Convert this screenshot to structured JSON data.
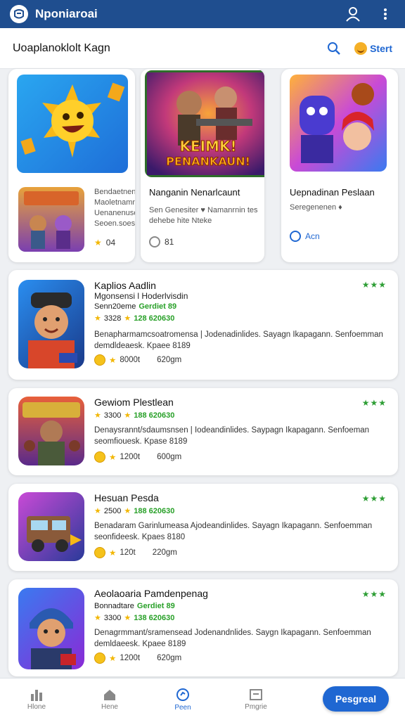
{
  "app": {
    "title": "Nponiaroai"
  },
  "subheader": {
    "title": "Uoaplanoklolt Kagn",
    "start_label": "Stert"
  },
  "featured": [
    {
      "title": "",
      "sub_lines": [
        "Bendaetnen",
        "Maoletnamn",
        "Uenanenuse",
        "Seoen.soes"
      ],
      "rating": "04"
    },
    {
      "title": "Nanganin Nenarlcaunt",
      "sub_lines": [
        "Sen Genesiter ♥ Namanrnin tes",
        "dehebe hite Nteke"
      ],
      "rating": "81",
      "banner_text": "PENANKAUN!",
      "banner_top": "KEIMK!"
    },
    {
      "title": "Uepnadinan Peslaan",
      "sub_lines": [
        "Seregenenen ♦"
      ],
      "rating": "Acn"
    }
  ],
  "list": [
    {
      "name": "Kaplios Aadlin",
      "subtitle": "Mgonsensi l Hoderlvisdin",
      "line2": "Senn20eme",
      "line2_green": "Gerdiet 89",
      "rating_line": "3328",
      "rating_green": "128 620630",
      "desc": "Benapharmamcsoatromensa | Jodenadinlides. Sayagn Ikapagann. Senfoemman demdldeaesk. Kpaee 8189",
      "meta_a": "8000t",
      "meta_b": "620gm",
      "stars": "★★★"
    },
    {
      "name": "Gewiom Plestlean",
      "subtitle": "",
      "line2": "",
      "line2_green": "",
      "rating_line": "3300",
      "rating_green": "188 620630",
      "desc": "Denaysrannt/sdaumsnsen | Iodeandinlides. Saypagn Ikapagann. Senfoeman seomfiouesk. Kpase 8189",
      "meta_a": "1200t",
      "meta_b": "600gm",
      "stars": "★★★"
    },
    {
      "name": "Hesuan Pesda",
      "subtitle": "",
      "line2": "",
      "line2_green": "",
      "rating_line": "2500",
      "rating_green": "188 620630",
      "desc": "Benadaram Garinlumeasa Ajodeandinlides. Sayagn Ikapagann. Senfoemman seonfideesk. Kpaes 8180",
      "meta_a": "120t",
      "meta_b": "220gm",
      "stars": "★★★"
    },
    {
      "name": "Aeolaoaria Pamdenpenag",
      "subtitle": "",
      "line2": "Bonnadtare",
      "line2_green": "Gerdiet 89",
      "rating_line": "3300",
      "rating_green": "138 620630",
      "desc": "Denagrmmant/sramensead Jodenandnlides. Saygn Ikapagann. Senfoemman demldaeesk. Kpaee 8189",
      "meta_a": "1200t",
      "meta_b": "620gm",
      "stars": "★★★"
    }
  ],
  "nav": [
    {
      "label": "Hlone",
      "icon": "chart-icon"
    },
    {
      "label": "Hene",
      "icon": "home-icon"
    },
    {
      "label": "Peen",
      "icon": "compass-icon"
    },
    {
      "label": "Pmgrie",
      "icon": "box-icon"
    }
  ],
  "cta": {
    "label": "Pesgreal"
  }
}
